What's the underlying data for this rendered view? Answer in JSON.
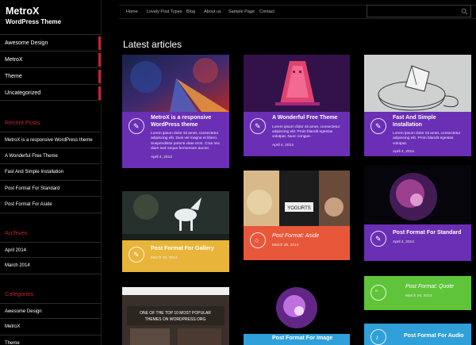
{
  "site": {
    "title": "MetroX",
    "tagline": "WordPress Theme"
  },
  "nav": [
    "Home",
    "Lovely Post Types",
    "Blog",
    "About us",
    "Sample Page",
    "Contact"
  ],
  "sidebar": {
    "categories": [
      "Awesome Design",
      "MetroX",
      "Theme",
      "Uncategorized"
    ],
    "recent_title": "Recent Posts",
    "recent": [
      "MetroX is a responsive WordPress theme",
      "A Wonderful Free Theme",
      "Fast And Simple Installation",
      "Post Format For Standard",
      "Post Format For Aside"
    ],
    "archives_title": "Archives",
    "archives": [
      "April 2014",
      "March 2014"
    ],
    "categories_title": "Categories",
    "categories2": [
      "Awesome Design",
      "MetroX",
      "Theme"
    ]
  },
  "main": {
    "heading": "Latest articles"
  },
  "cards": [
    {
      "title": "MetroX is a responsive WordPress theme",
      "excerpt": "Lorem ipsum dolor sit amet, consectetur adipiscing elit. Duis vel magna et libero. Suspendisse potenti vitae eros. Cras nec diam sed neque fermentum auctor.",
      "date": "April 4, 2014",
      "color": "#6a2fb5",
      "icon": "pencil"
    },
    {
      "title": "A Wonderful Free Theme",
      "excerpt": "Lorem ipsum dolor sit amet, consectetur adipiscing elit. Proin blandit egestas volutpat. Nunc congue.",
      "date": "April 4, 2014",
      "color": "#6a2fb5",
      "icon": "pencil"
    },
    {
      "title": "Fast And Simple Installation",
      "excerpt": "Lorem ipsum dolor sit amet, consectetur adipiscing elit. Proin blandit egestas volutpat.",
      "date": "April 4, 2014",
      "color": "#6a2fb5",
      "icon": "pencil"
    },
    {
      "title": "Post Format: Aside",
      "date": "March 26, 2014",
      "color": "#e8573a",
      "icon": "circle"
    },
    {
      "title": "Post Format For Gallery",
      "date": "March 26, 2014",
      "color": "#e8b53a",
      "icon": "pencil"
    },
    {
      "title": "Post Format For Standard",
      "date": "April 4, 2014",
      "color": "#6a2fb5",
      "icon": "pencil"
    },
    {
      "title": "Post Format: Quote",
      "date": "March 26, 2014",
      "color": "#5fc43a",
      "icon": "quote"
    },
    {
      "title": "Post Format For Image",
      "color": "#e8b53a",
      "icon": "image"
    },
    {
      "title": "Post Format For Audio",
      "color": "#2fa0d8",
      "icon": "note"
    }
  ]
}
